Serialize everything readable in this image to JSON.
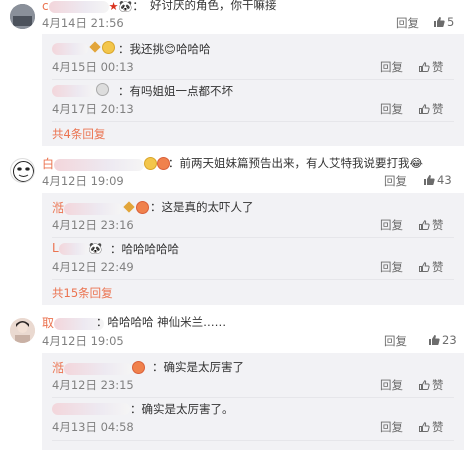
{
  "comments": [
    {
      "user": "c",
      "text": "好讨厌的角色，你干嘛接",
      "time": "4月14日 21:56",
      "reply_label": "回复",
      "likes": "5",
      "replies": [
        {
          "user": "",
          "text": "：我还挑😊哈哈哈",
          "time": "4月15日 00:13",
          "reply_label": "回复",
          "like_label": "赞"
        },
        {
          "user": "",
          "text": "：有吗姐姐一点都不坏",
          "time": "4月17日 20:13",
          "reply_label": "回复",
          "like_label": "赞"
        }
      ],
      "more": "共4条回复"
    },
    {
      "user": "白",
      "text": "：前两天姐妹篇预告出来，有人艾特我说要打我😂",
      "time": "4月12日 19:09",
      "reply_label": "回复",
      "likes": "43",
      "replies": [
        {
          "user": "湉",
          "text": "：这是真的太吓人了",
          "time": "4月12日 23:16",
          "reply_label": "回复",
          "like_label": "赞"
        },
        {
          "user": "L",
          "text": "：哈哈哈哈哈",
          "time": "4月12日 22:49",
          "reply_label": "回复",
          "like_label": "赞"
        }
      ],
      "more": "共15条回复"
    },
    {
      "user": "取",
      "text": "：哈哈哈哈  神仙米兰……",
      "time": "4月12日 19:05",
      "reply_label": "回复",
      "likes": "23",
      "replies": [
        {
          "user": "湉",
          "text": "：确实是太厉害了",
          "time": "4月12日 23:15",
          "reply_label": "回复",
          "like_label": "赞"
        },
        {
          "user": "",
          "text": "：确实是太厉害了。",
          "time": "4月13日 04:58",
          "reply_label": "回复",
          "like_label": "赞"
        }
      ]
    }
  ],
  "colors": {
    "link": "#eb7350",
    "panel": "#f2f2f5",
    "muted": "#808080"
  },
  "icons": {
    "like": "thumb-up-icon",
    "reply_like": "thumb-up-outline-icon"
  }
}
